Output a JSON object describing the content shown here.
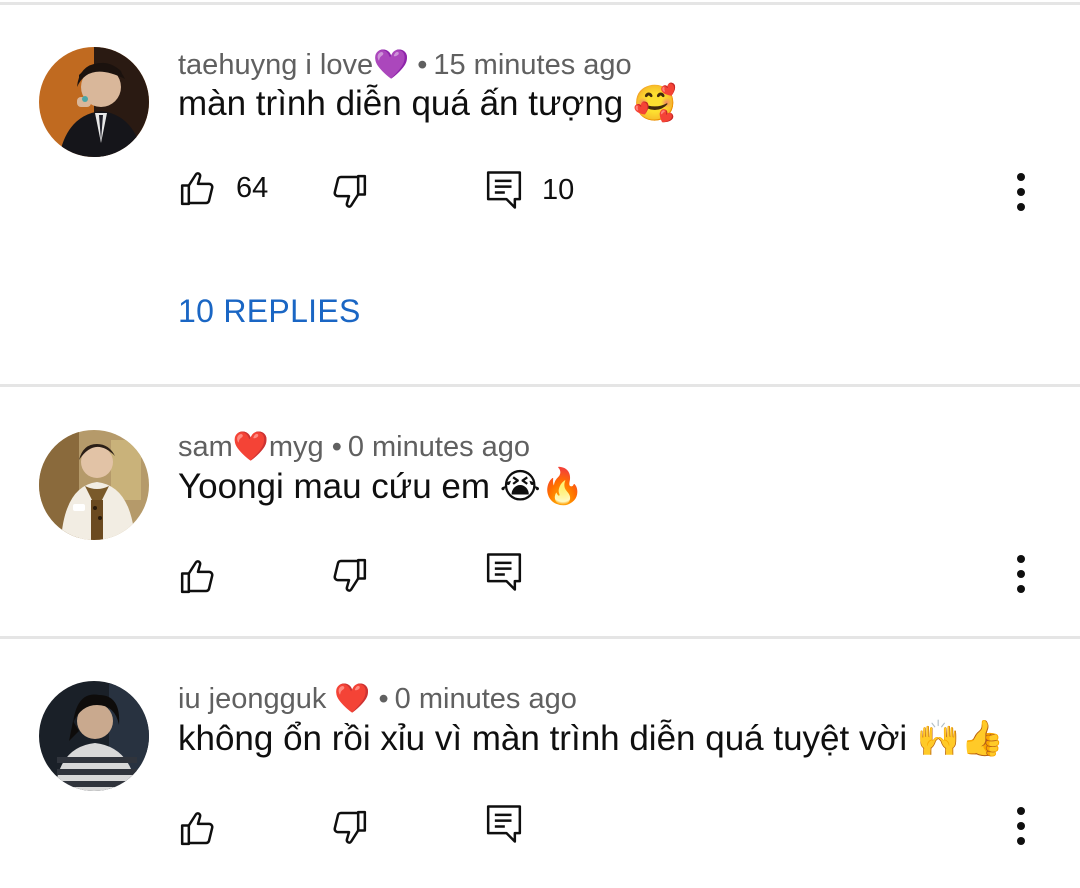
{
  "comments": [
    {
      "username": "taehuyng i love💜",
      "separator": "•",
      "timestamp": "15 minutes ago",
      "text": "màn trình diễn quá ấn tượng 🥰",
      "like_count": "64",
      "reply_count": "10",
      "replies_label": "10 REPLIES"
    },
    {
      "username": "sam❤️myg",
      "separator": "•",
      "timestamp": "0 minutes ago",
      "text": "Yoongi mau cứu em 😭🔥",
      "like_count": "",
      "reply_count": ""
    },
    {
      "username": "iu jeongguk ❤️",
      "separator": "•",
      "timestamp": "0 minutes ago",
      "text": "không ổn rồi xỉu vì màn trình diễn quá tuyệt vời 🙌👍",
      "like_count": "",
      "reply_count": ""
    }
  ],
  "icons": {
    "like": "thumbs-up-outline",
    "dislike": "thumbs-down-outline",
    "reply": "comment-outline",
    "more": "three-dots-vertical"
  },
  "colors": {
    "link": "#1a66c4",
    "meta_text": "#606060",
    "text": "#0f0f0f",
    "divider": "#e5e5e5"
  }
}
